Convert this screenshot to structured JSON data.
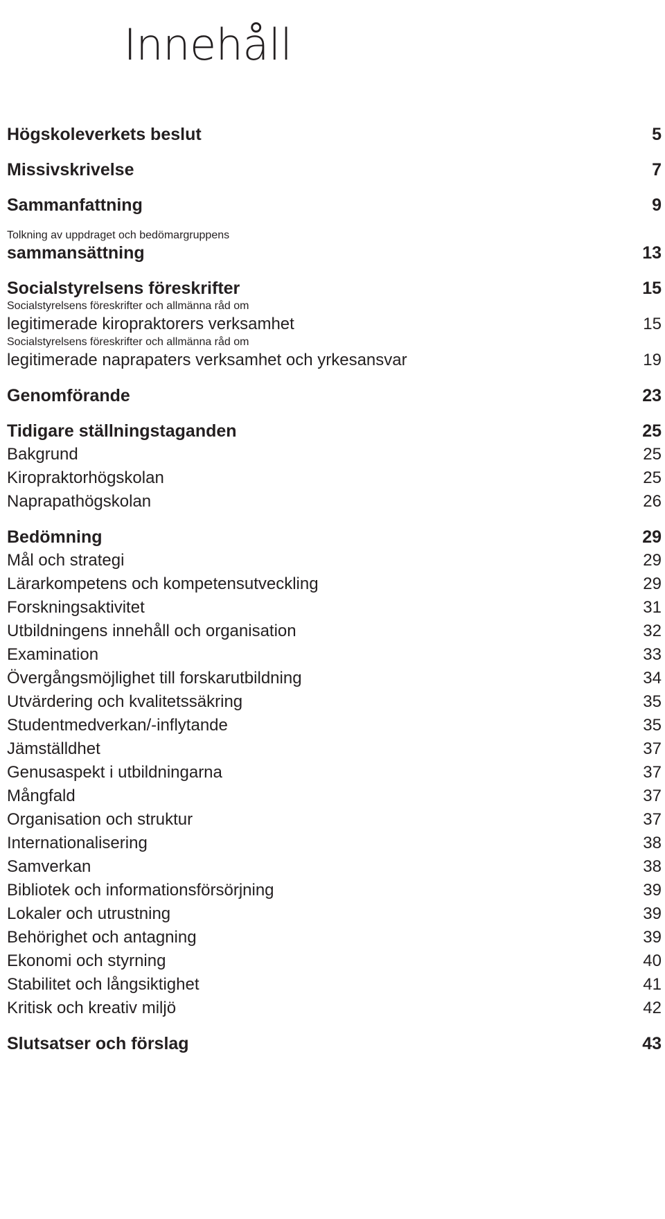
{
  "document": {
    "title": "Innehåll",
    "language": "sv",
    "text_color": "#231f20",
    "background_color": "#ffffff"
  },
  "toc": {
    "entries": [
      {
        "id": "e0",
        "level": "head",
        "lines": [
          "Högskoleverkets beslut"
        ],
        "page": "5"
      },
      {
        "id": "e1",
        "level": "head",
        "lines": [
          "Missivskrivelse"
        ],
        "page": "7"
      },
      {
        "id": "e2",
        "level": "head",
        "lines": [
          "Sammanfattning"
        ],
        "page": "9"
      },
      {
        "id": "e3",
        "level": "head",
        "lines": [
          "Tolkning av uppdraget och bedömargruppens",
          "sammansättning"
        ],
        "page": "13"
      },
      {
        "id": "e4",
        "level": "head",
        "lines": [
          "Socialstyrelsens föreskrifter"
        ],
        "page": "15"
      },
      {
        "id": "e5",
        "level": "sub",
        "lines": [
          "Socialstyrelsens föreskrifter och allmänna råd om",
          "legitimerade kiropraktorers verksamhet"
        ],
        "page": "15"
      },
      {
        "id": "e6",
        "level": "sub",
        "lines": [
          "Socialstyrelsens föreskrifter och allmänna råd om",
          "legitimerade naprapaters verksamhet och yrkesansvar"
        ],
        "page": "19"
      },
      {
        "id": "e7",
        "level": "head",
        "lines": [
          "Genomförande"
        ],
        "page": "23"
      },
      {
        "id": "e8",
        "level": "head",
        "lines": [
          "Tidigare ställningstaganden"
        ],
        "page": "25"
      },
      {
        "id": "e9",
        "level": "sub",
        "lines": [
          "Bakgrund"
        ],
        "page": "25"
      },
      {
        "id": "e10",
        "level": "sub",
        "lines": [
          "Kiropraktorhögskolan"
        ],
        "page": "25"
      },
      {
        "id": "e11",
        "level": "sub",
        "lines": [
          "Naprapathögskolan"
        ],
        "page": "26"
      },
      {
        "id": "e12",
        "level": "head",
        "lines": [
          "Bedömning"
        ],
        "page": "29"
      },
      {
        "id": "e13",
        "level": "sub",
        "lines": [
          "Mål och strategi"
        ],
        "page": "29"
      },
      {
        "id": "e14",
        "level": "sub",
        "lines": [
          "Lärarkompetens och kompetensutveckling"
        ],
        "page": "29"
      },
      {
        "id": "e15",
        "level": "sub",
        "lines": [
          "Forskningsaktivitet"
        ],
        "page": "31"
      },
      {
        "id": "e16",
        "level": "sub",
        "lines": [
          "Utbildningens innehåll och organisation"
        ],
        "page": "32"
      },
      {
        "id": "e17",
        "level": "sub",
        "lines": [
          "Examination"
        ],
        "page": "33"
      },
      {
        "id": "e18",
        "level": "sub",
        "lines": [
          "Övergångsmöjlighet till forskarutbildning"
        ],
        "page": "34"
      },
      {
        "id": "e19",
        "level": "sub",
        "lines": [
          "Utvärdering och kvalitetssäkring"
        ],
        "page": "35"
      },
      {
        "id": "e20",
        "level": "sub",
        "lines": [
          "Studentmedverkan/-inflytande"
        ],
        "page": "35"
      },
      {
        "id": "e21",
        "level": "sub",
        "lines": [
          "Jämställdhet"
        ],
        "page": "37"
      },
      {
        "id": "e22",
        "level": "sub",
        "lines": [
          "Genusaspekt i utbildningarna"
        ],
        "page": "37"
      },
      {
        "id": "e23",
        "level": "sub",
        "lines": [
          "Mångfald"
        ],
        "page": "37"
      },
      {
        "id": "e24",
        "level": "sub",
        "lines": [
          "Organisation och struktur"
        ],
        "page": "37"
      },
      {
        "id": "e25",
        "level": "sub",
        "lines": [
          "Internationalisering"
        ],
        "page": "38"
      },
      {
        "id": "e26",
        "level": "sub",
        "lines": [
          "Samverkan"
        ],
        "page": "38"
      },
      {
        "id": "e27",
        "level": "sub",
        "lines": [
          "Bibliotek och informationsförsörjning"
        ],
        "page": "39"
      },
      {
        "id": "e28",
        "level": "sub",
        "lines": [
          "Lokaler och utrustning"
        ],
        "page": "39"
      },
      {
        "id": "e29",
        "level": "sub",
        "lines": [
          "Behörighet och antagning"
        ],
        "page": "39"
      },
      {
        "id": "e30",
        "level": "sub",
        "lines": [
          "Ekonomi och styrning"
        ],
        "page": "40"
      },
      {
        "id": "e31",
        "level": "sub",
        "lines": [
          "Stabilitet och långsiktighet"
        ],
        "page": "41"
      },
      {
        "id": "e32",
        "level": "sub",
        "lines": [
          "Kritisk och kreativ miljö"
        ],
        "page": "42"
      },
      {
        "id": "e33",
        "level": "head",
        "lines": [
          "Slutsatser och förslag"
        ],
        "page": "43"
      }
    ]
  }
}
